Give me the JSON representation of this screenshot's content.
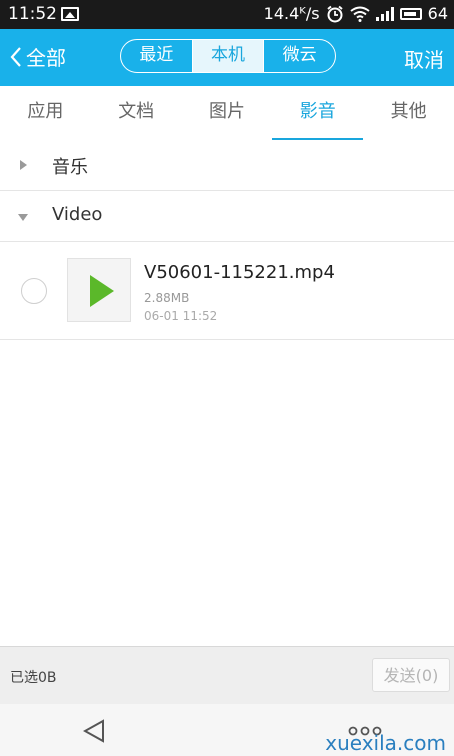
{
  "status_bar": {
    "time": "11:52",
    "speed": "14.4ᴷ/s",
    "battery": "64",
    "icons": [
      "image-icon",
      "alarm-icon",
      "wifi-icon",
      "signal-icon",
      "battery-icon"
    ]
  },
  "title_bar": {
    "back_label": "全部",
    "segments": [
      {
        "label": "最近",
        "active": false
      },
      {
        "label": "本机",
        "active": true
      },
      {
        "label": "微云",
        "active": false
      }
    ],
    "cancel_label": "取消",
    "accent_color": "#19b1ea"
  },
  "tabs": [
    {
      "label": "应用",
      "active": false
    },
    {
      "label": "文档",
      "active": false
    },
    {
      "label": "图片",
      "active": false
    },
    {
      "label": "影音",
      "active": true
    },
    {
      "label": "其他",
      "active": false
    }
  ],
  "groups": [
    {
      "label": "音乐",
      "expanded": false
    },
    {
      "label": "Video",
      "expanded": true
    }
  ],
  "files": [
    {
      "name": "V50601-115221.mp4",
      "size": "2.88MB",
      "date": "06-01 11:52",
      "selected": false,
      "icon": "play-icon"
    }
  ],
  "bottom_bar": {
    "selected_text": "已选0B",
    "send_label": "发送(0)"
  },
  "watermark": "xuexila.com"
}
